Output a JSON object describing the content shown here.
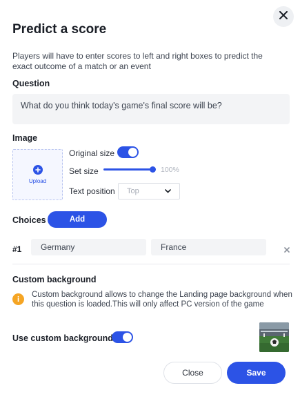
{
  "dialog": {
    "title": "Predict a score",
    "description": "Players will have to enter scores to left and right boxes to predict the exact outcome of a match or an event",
    "close_icon": "close-icon"
  },
  "question": {
    "label": "Question",
    "value": "What do you think today's game's final score will be?"
  },
  "image": {
    "label": "Image",
    "upload_label": "Upload",
    "original_size_label": "Original size",
    "original_size_on": true,
    "set_size_label": "Set size",
    "set_size_percent": 100,
    "set_size_value": "100%",
    "text_position_label": "Text position",
    "text_position_value": "Top"
  },
  "choices": {
    "label": "Choices",
    "add_label": "Add",
    "items": [
      {
        "number": "#1",
        "left": "Germany",
        "right": "France"
      }
    ]
  },
  "custom_background": {
    "heading": "Custom background",
    "info": "Custom background allows to change the Landing page background when this question is loaded.This will only affect PC version of the game",
    "use_label": "Use custom background",
    "use_on": true
  },
  "footer": {
    "close_label": "Close",
    "save_label": "Save"
  },
  "colors": {
    "accent": "#2c53e6",
    "warning": "#f5a524"
  }
}
